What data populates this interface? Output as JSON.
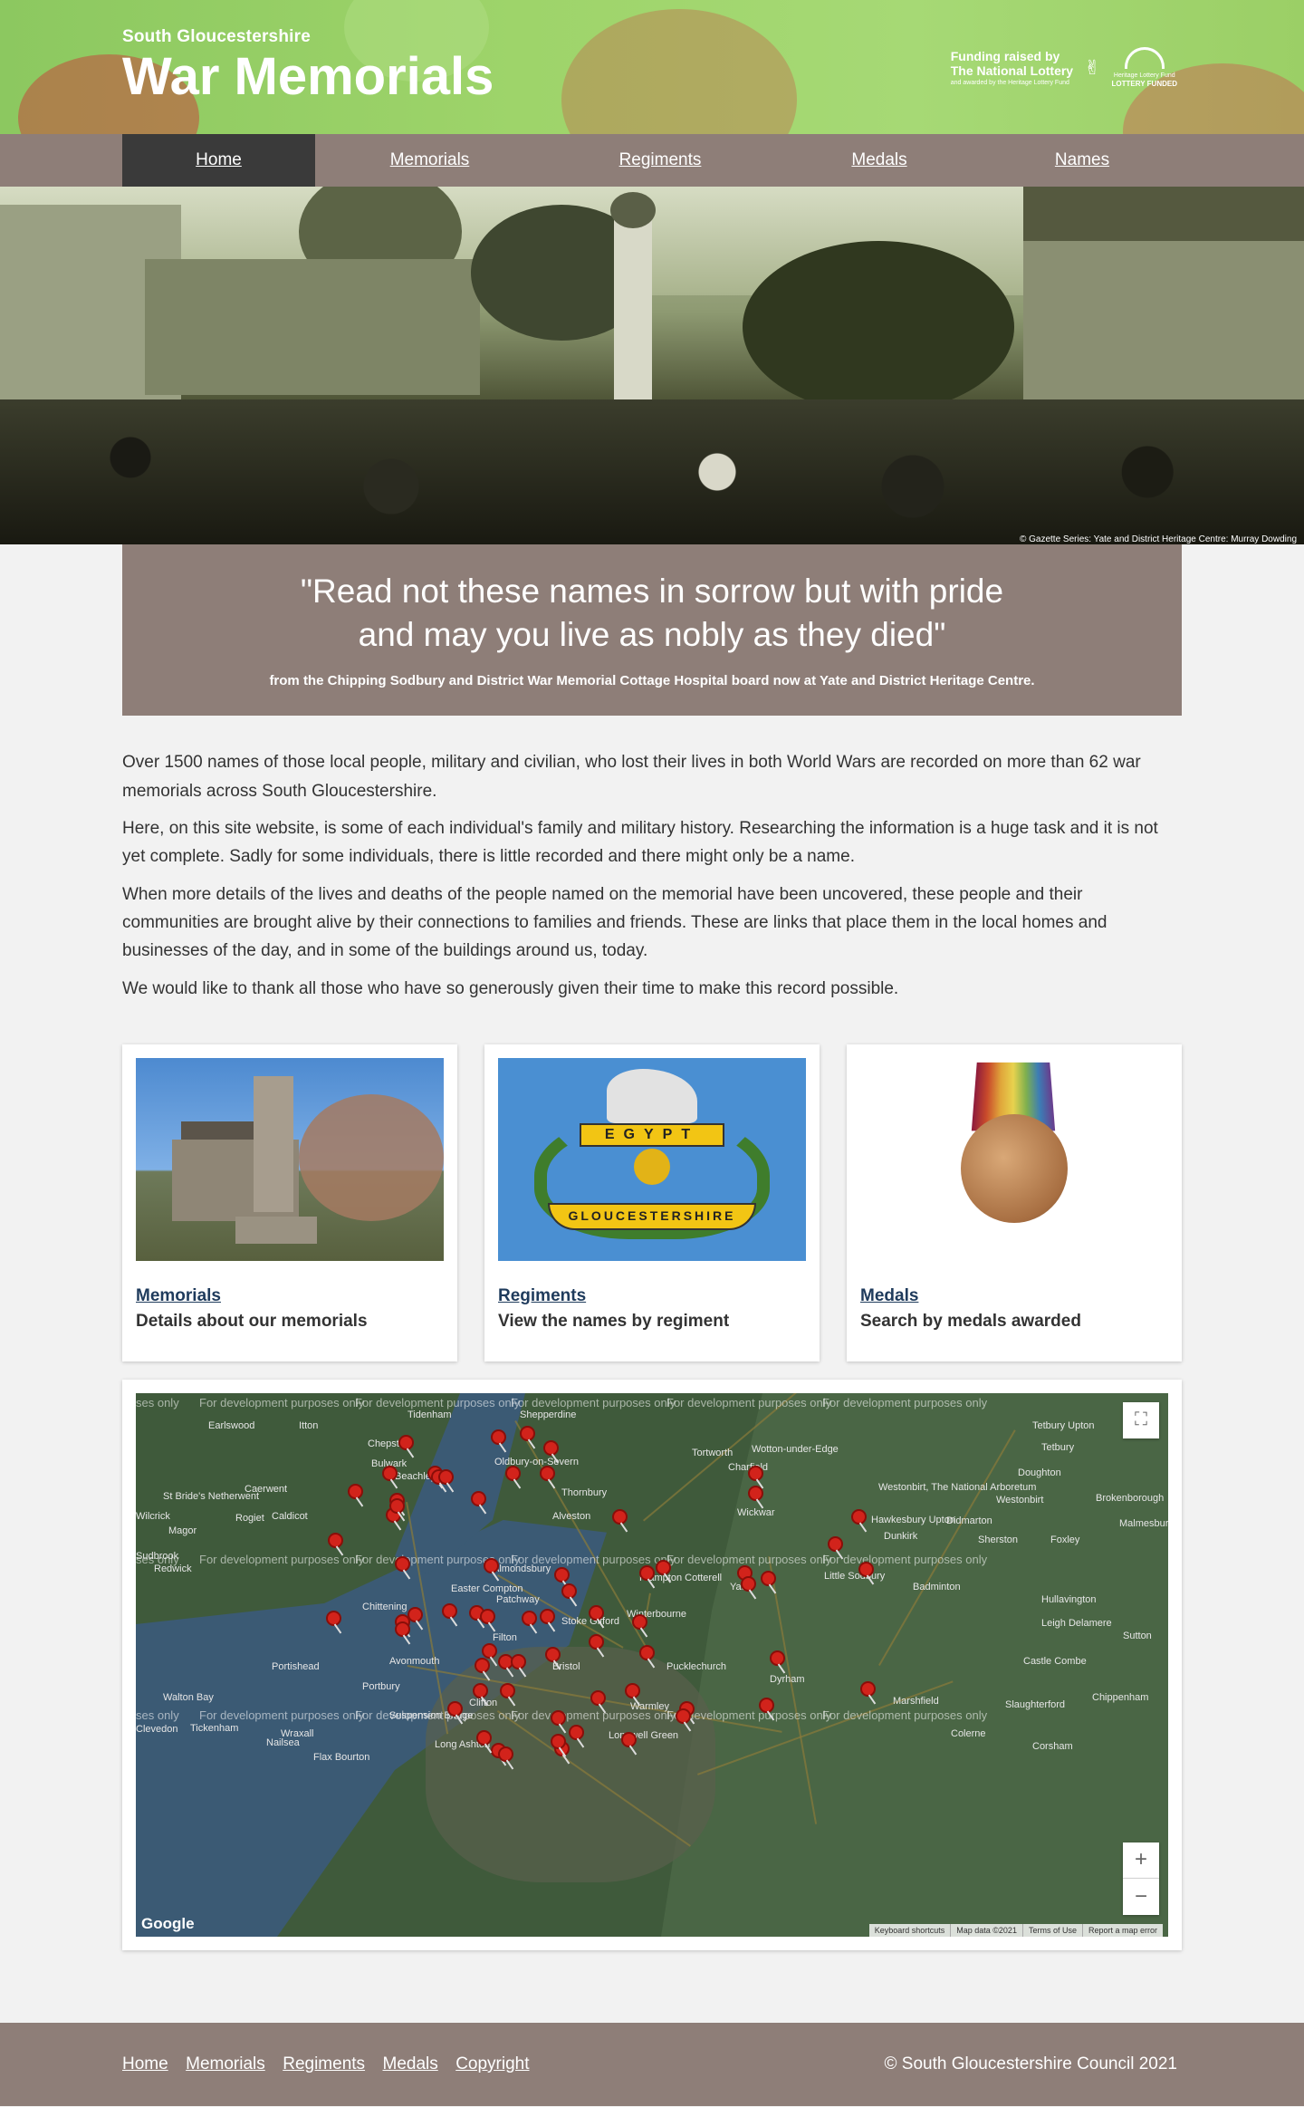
{
  "header": {
    "subtitle": "South Gloucestershire",
    "title": "War Memorials",
    "lottery": {
      "line1": "Funding raised by",
      "line2": "The National Lottery",
      "small": "and awarded by the Heritage Lottery Fund",
      "fund_name": "Heritage Lottery Fund",
      "fund_label": "LOTTERY FUNDED"
    }
  },
  "nav": [
    {
      "label": "Home",
      "active": true
    },
    {
      "label": "Memorials",
      "active": false
    },
    {
      "label": "Regiments",
      "active": false
    },
    {
      "label": "Medals",
      "active": false
    },
    {
      "label": "Names",
      "active": false
    }
  ],
  "hero": {
    "credit": "© Gazette Series: Yate and District Heritage Centre: Murray Dowding"
  },
  "quote": {
    "line1": "\"Read not these names in sorrow but with pride",
    "line2": "and may you live as nobly as they died\"",
    "source": "from the Chipping Sodbury and District War Memorial Cottage Hospital board now at Yate and District Heritage Centre."
  },
  "intro": [
    "Over 1500 names of those local people, military and civilian, who lost their lives in both World Wars are recorded on more than 62 war memorials across South Gloucestershire.",
    "Here, on this site website, is some of each individual's family and military history. Researching the information is a huge task and it is not yet complete. Sadly for some individuals, there is little recorded and there might only be a name.",
    "When more details of the lives and deaths of the people named on the memorial have been uncovered, these people and their communities are brought alive by their connections to families and friends. These are links that place them in the local homes and businesses of the day, and in some of the buildings around us, today.",
    "We would like to thank all those who have so generously given their time to make this record possible."
  ],
  "cards": [
    {
      "link": "Memorials",
      "desc": "Details about our memorials"
    },
    {
      "link": "Regiments",
      "desc": "View the names by regiment",
      "badge_top": "EGYPT",
      "badge_scroll": "GLOUCESTERSHIRE"
    },
    {
      "link": "Medals",
      "desc": "Search by medals awarded"
    }
  ],
  "map": {
    "dev_text": "For development purposes only",
    "dev_text_partial": "ses only",
    "places": [
      "Tidenham",
      "Shepperdine",
      "Earlswood",
      "Itton",
      "Chepstow",
      "Bulwark",
      "Oldbury-on-Severn",
      "Tortworth",
      "Wotton-under-Edge",
      "Charfield",
      "Tetbury Upton",
      "Tetbury",
      "Beachley",
      "Caerwent",
      "Thornbury",
      "Westonbirt, The National Arboretum",
      "Doughton",
      "St Bride's Netherwent",
      "Rogiet",
      "Caldicot",
      "Wilcrick",
      "Alveston",
      "Wickwar",
      "Westonbirt",
      "Brokenborough",
      "Magor",
      "Hawkesbury Upton",
      "Didmarton",
      "Malmesbury",
      "Dunkirk",
      "Sherston",
      "Foxley",
      "Sudbrook",
      "Redwick",
      "Almondsbury",
      "Frampton Cotterell",
      "Yate",
      "Little Sodbury",
      "Badminton",
      "Hullavington",
      "Easter Compton",
      "Patchway",
      "Chittening",
      "Filton",
      "Stoke Gifford",
      "Winterbourne",
      "Leigh Delamere",
      "Sutton",
      "Avonmouth",
      "Portishead",
      "Pucklechurch",
      "Castle Combe",
      "Dyrham",
      "Portbury",
      "Walton Bay",
      "Clifton",
      "Suspension Bridge",
      "Warmley",
      "Marshfield",
      "Slaughterford",
      "Chippenham",
      "Clevedon",
      "Tickenham",
      "Wraxall",
      "Nailsea",
      "Longwell Green",
      "Colerne",
      "Long Ashton",
      "Flax Bourton",
      "Corsham",
      "Bristol"
    ],
    "google": "Google",
    "attribution": [
      "Keyboard shortcuts",
      "Map data ©2021",
      "Terms of Use",
      "Report a map error"
    ]
  },
  "footer": {
    "links": [
      "Home",
      "Memorials",
      "Regiments",
      "Medals",
      "Copyright"
    ],
    "copyright": "© South Gloucestershire Council 2021"
  }
}
